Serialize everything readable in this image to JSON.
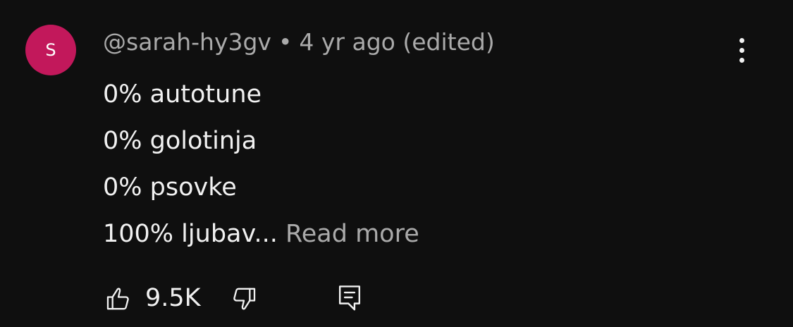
{
  "comment": {
    "avatar_initial": "S",
    "avatar_color": "#c2185b",
    "author": "@sarah-hy3gv",
    "separator": "•",
    "time": "4 yr ago (edited)",
    "lines": [
      "0% autotune",
      "0% golotinja",
      "0% psovke",
      "100% ljubav..."
    ],
    "read_more": "Read more",
    "like_count": "9.5K",
    "icons": {
      "menu": "more-vertical-icon",
      "like": "thumbs-up-icon",
      "dislike": "thumbs-down-icon",
      "reply": "comment-reply-icon"
    }
  },
  "colors": {
    "background": "#0f0f0f",
    "text_primary": "#f1f1f1",
    "text_secondary": "#aaaaaa"
  }
}
